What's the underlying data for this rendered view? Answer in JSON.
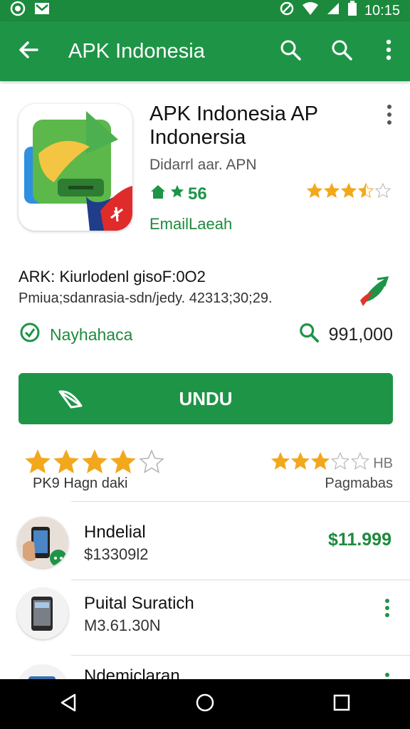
{
  "status_bar": {
    "time": "10:15",
    "left_icons": [
      "whatsapp-icon",
      "gmail-icon"
    ],
    "right_icons": [
      "no-sim-icon",
      "wifi-icon",
      "signal-icon",
      "battery-icon"
    ]
  },
  "app_bar": {
    "title": "APK Indonesia",
    "icons": [
      "back-arrow-icon",
      "search-icon",
      "search-icon",
      "more-vert-icon"
    ]
  },
  "app": {
    "title": "APK Indonesia AP Indonersia",
    "developer": "Didarrl aar. APN",
    "score": "56",
    "stars": 3.5,
    "category": "EmailLaeah"
  },
  "info": {
    "line1": "ARK: Kiurlodenl gisoF:0O2",
    "line2": "Pmiua;sdanrasia-sdn/jedy. 42313;30;29."
  },
  "meta": {
    "left_label": "Nayhahaca",
    "right_value": "991,000"
  },
  "install": {
    "label": "UNDU"
  },
  "ratings": {
    "left_stars": 4,
    "left_label": "PK9 Hagn daki",
    "right_stars": 3,
    "right_badge": "HB",
    "right_label": "Pagmabas"
  },
  "list": [
    {
      "title": "Hndelial",
      "subtitle": "$13309l2",
      "price": "$11.999"
    },
    {
      "title": "Puital Suratich",
      "subtitle": "M3.61.30N"
    },
    {
      "title": "Ndemiclaran"
    }
  ],
  "colors": {
    "primary": "#1e9447",
    "status_bar": "#1b8a3c",
    "star": "#f2a81d",
    "navbar": "#000000"
  }
}
